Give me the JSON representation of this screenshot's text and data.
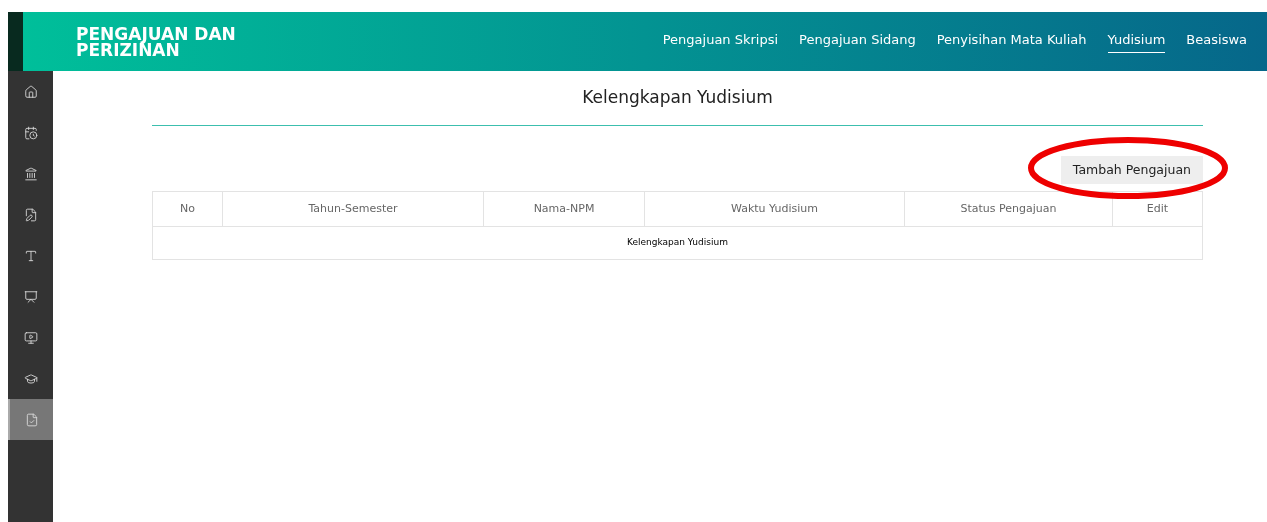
{
  "header": {
    "title": "PENGAJUAN DAN PERIZINAN",
    "nav": [
      {
        "label": "Pengajuan Skripsi",
        "selected": false
      },
      {
        "label": "Pengajuan Sidang",
        "selected": false
      },
      {
        "label": "Penyisihan Mata Kuliah",
        "selected": false
      },
      {
        "label": "Yudisium",
        "selected": true
      },
      {
        "label": "Beasiswa",
        "selected": false
      }
    ]
  },
  "sidebar": {
    "items": [
      {
        "selected": false
      },
      {
        "selected": false
      },
      {
        "selected": false
      },
      {
        "selected": false
      },
      {
        "selected": false
      },
      {
        "selected": false
      },
      {
        "selected": false
      },
      {
        "selected": false
      },
      {
        "selected": true
      }
    ]
  },
  "page": {
    "title": "Kelengkapan Yudisium",
    "add_button": "Tambah Pengajuan"
  },
  "table": {
    "columns": [
      "No",
      "Tahun-Semester",
      "Nama-NPM",
      "Waktu Yudisium",
      "Status Pengajuan",
      "Edit"
    ],
    "empty_message": "Kelengkapan Yudisium"
  }
}
